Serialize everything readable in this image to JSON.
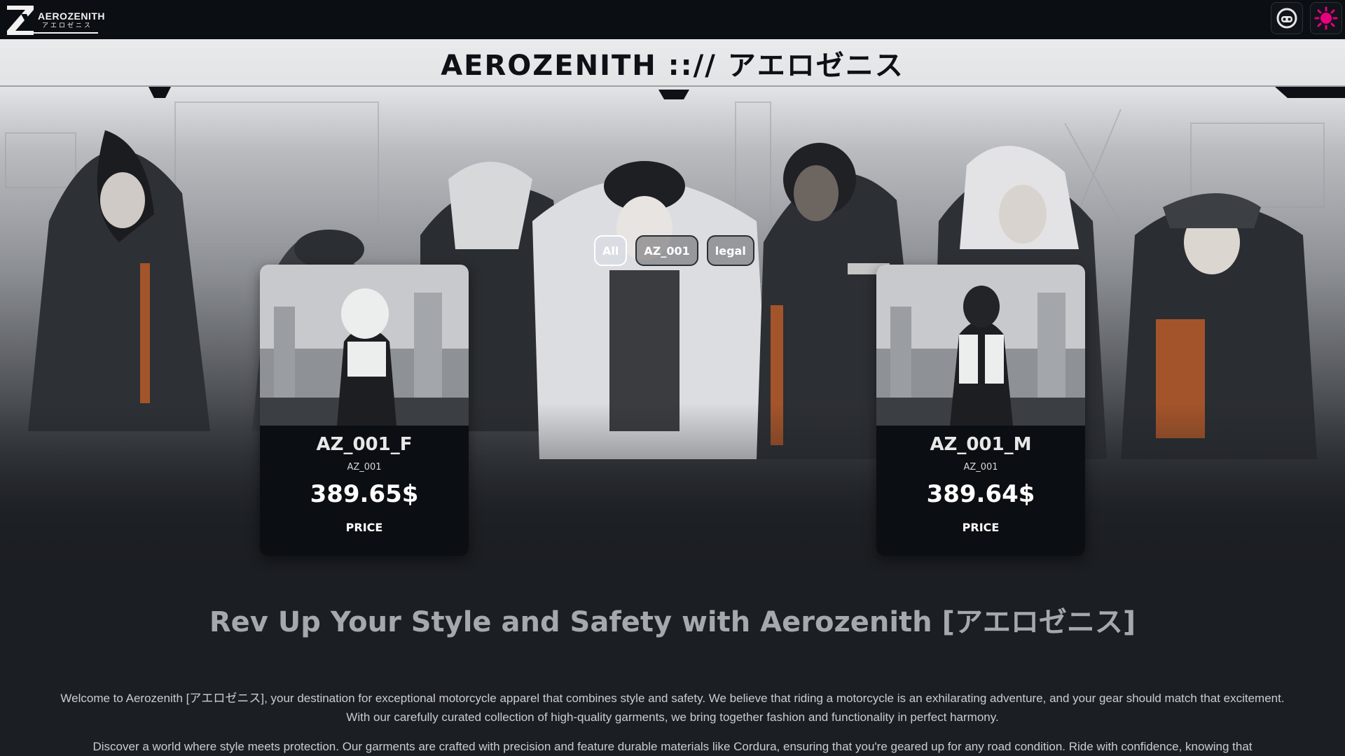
{
  "brand": {
    "logo_text": "AEROZENITH",
    "logo_sub": "アエロゼニス",
    "title": "AEROZENITH ::// アエロゼニス"
  },
  "topbar": {
    "user_icon": "robot-face-icon",
    "theme_icon": "sun-icon",
    "theme_color": "#e6007e"
  },
  "filters": [
    {
      "label": "All",
      "active": true
    },
    {
      "label": "AZ_001",
      "active": false
    },
    {
      "label": "legal",
      "active": false
    }
  ],
  "products": [
    {
      "name": "AZ_001_F",
      "collection": "AZ_001",
      "price": "389.65$",
      "price_label": "PRICE"
    },
    {
      "name": "AZ_001_M",
      "collection": "AZ_001",
      "price": "389.64$",
      "price_label": "PRICE"
    }
  ],
  "content": {
    "headline": "Rev Up Your Style and Safety with Aerozenith [アエロゼニス]",
    "paragraph1": "Welcome to Aerozenith [アエロゼニス], your destination for exceptional motorcycle apparel that combines style and safety. We believe that riding a motorcycle is an exhilarating adventure, and your gear should match that excitement. With our carefully curated collection of high-quality garments, we bring together fashion and functionality in perfect harmony.",
    "paragraph2": "Discover a world where style meets protection. Our garments are crafted with precision and feature durable materials like Cordura, ensuring that you're geared up for any road condition. Ride with confidence, knowing that"
  }
}
